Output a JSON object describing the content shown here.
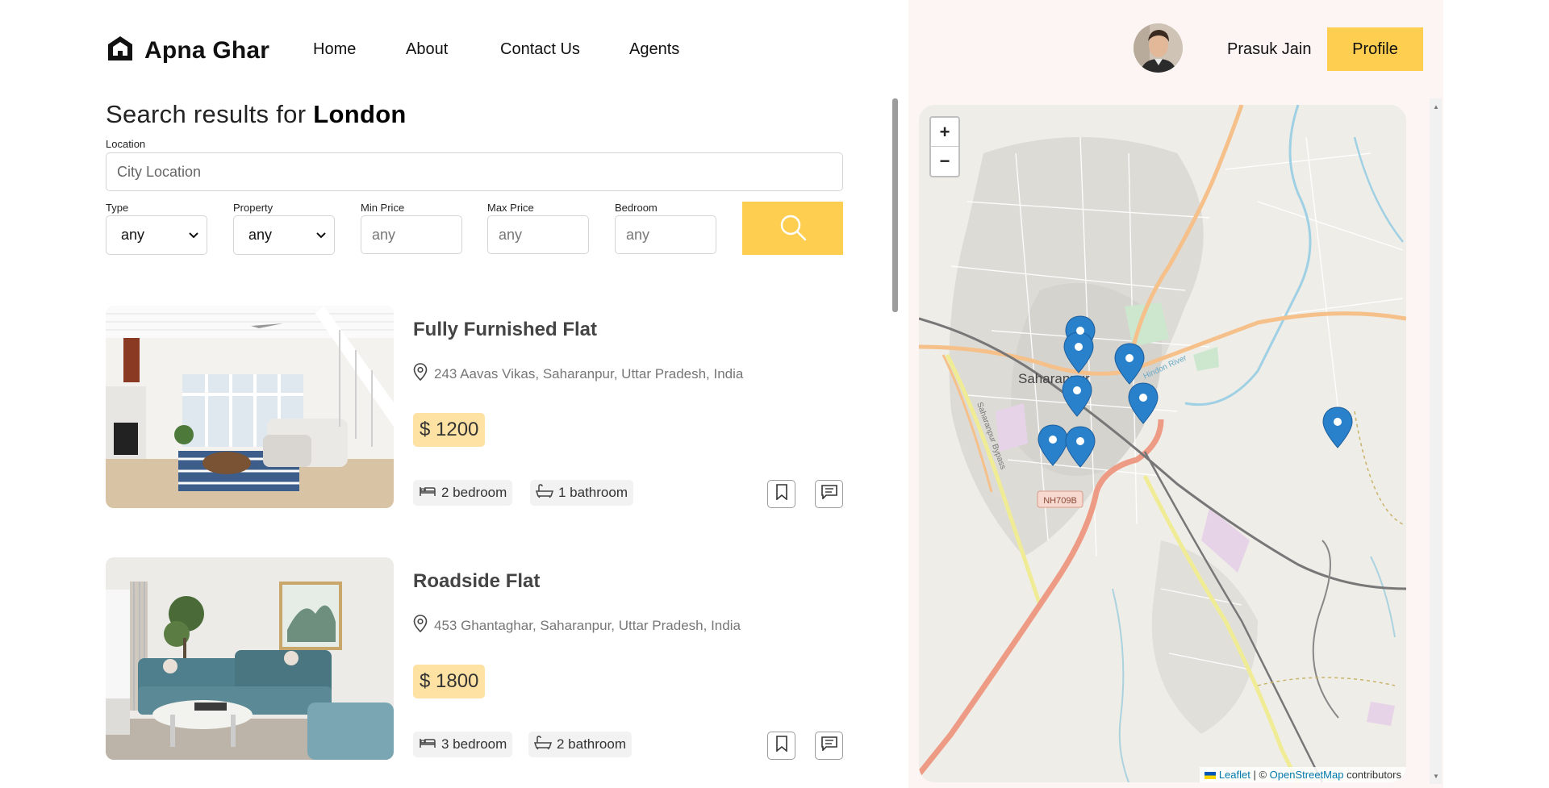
{
  "brand": {
    "name": "Apna Ghar"
  },
  "nav": {
    "links": [
      "Home",
      "About",
      "Contact Us",
      "Agents"
    ]
  },
  "user": {
    "name": "Prasuk Jain",
    "profile_label": "Profile"
  },
  "search": {
    "prefix": "Search results for ",
    "city": "London",
    "location_label": "Location",
    "location_placeholder": "City Location",
    "type_label": "Type",
    "type_value": "any",
    "property_label": "Property",
    "property_value": "any",
    "min_price_label": "Min Price",
    "min_price_placeholder": "any",
    "max_price_label": "Max Price",
    "max_price_placeholder": "any",
    "bedroom_label": "Bedroom",
    "bedroom_placeholder": "any"
  },
  "listings": [
    {
      "title": "Fully Furnished Flat",
      "address": "243 Aavas Vikas, Saharanpur, Uttar Pradesh, India",
      "price": "$ 1200",
      "bedroom": "2 bedroom",
      "bathroom": "1 bathroom"
    },
    {
      "title": "Roadside Flat",
      "address": "453 Ghantaghar, Saharanpur, Uttar Pradesh, India",
      "price": "$ 1800",
      "bedroom": "3 bedroom",
      "bathroom": "2 bathroom"
    }
  ],
  "map": {
    "zoom_in": "+",
    "zoom_out": "−",
    "city_label": "Saharanpur",
    "road_label": "NH709B",
    "highway_label": "Saharanpur Bypass",
    "river_label": "Hindon River",
    "attribution_leaflet": "Leaflet",
    "attribution_sep": " | © ",
    "attribution_osm": "OpenStreetMap",
    "attribution_suffix": " contributors",
    "marker_count": 8
  },
  "colors": {
    "accent": "#fece51",
    "price_bg": "#fde2a4",
    "panel_bg": "#fcf5f3",
    "marker": "#2a81cb"
  }
}
